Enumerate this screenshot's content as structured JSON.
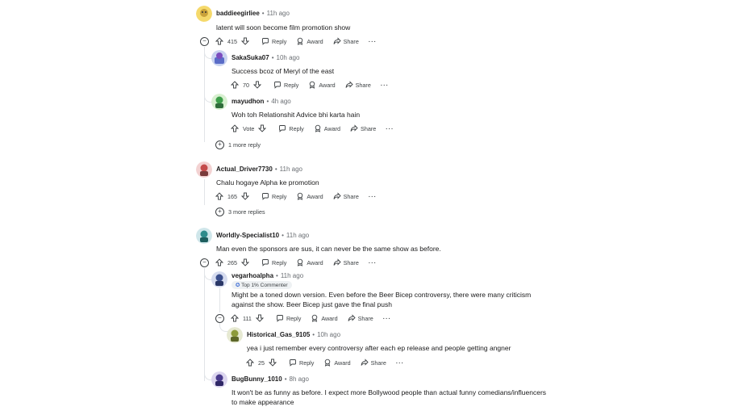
{
  "labels": {
    "reply": "Reply",
    "award": "Award",
    "share": "Share",
    "dots": "···"
  },
  "comments": [
    {
      "user": "baddieegirliee",
      "time": "11h ago",
      "text": "latent will soon become film promotion show",
      "votes": "415"
    },
    {
      "user": "SakaSuka07",
      "time": "10h ago",
      "text": "Success bcoz of Meryl of the east",
      "votes": "70"
    },
    {
      "user": "mayudhon",
      "time": "4h ago",
      "text": "Woh toh Relationshit Advice bhi karta hain",
      "votes": "Vote"
    },
    {
      "user": "Actual_Driver7730",
      "time": "11h ago",
      "text": "Chalu hogaye Alpha ke promotion",
      "votes": "165"
    },
    {
      "user": "Worldly-Specialist10",
      "time": "11h ago",
      "text": "Man even the sponsors are sus, it can never be the same show as before.",
      "votes": "265"
    },
    {
      "user": "vegarhoalpha",
      "time": "11h ago",
      "badge": "Top 1% Commenter",
      "text1": "Might be a toned down version. Even before the Beer Bicep controversy, there were many criticism",
      "text2": "against the show. Beer Bicep just gave the final push",
      "votes": "111"
    },
    {
      "user": "Historical_Gas_9105",
      "time": "10h ago",
      "text": "yea i just remember every controversy after each ep release and people getting angner",
      "votes": "25"
    },
    {
      "user": "BugBunny_1010",
      "time": "8h ago",
      "text1": "It won't be as funny as before. I expect more Bollywood people than actual funny comedians/influencers",
      "text2": "to make appearance"
    }
  ],
  "more_replies": [
    "1 more reply",
    "3 more replies"
  ],
  "separator": "•",
  "toggle_minus": "−",
  "toggle_plus": "+"
}
